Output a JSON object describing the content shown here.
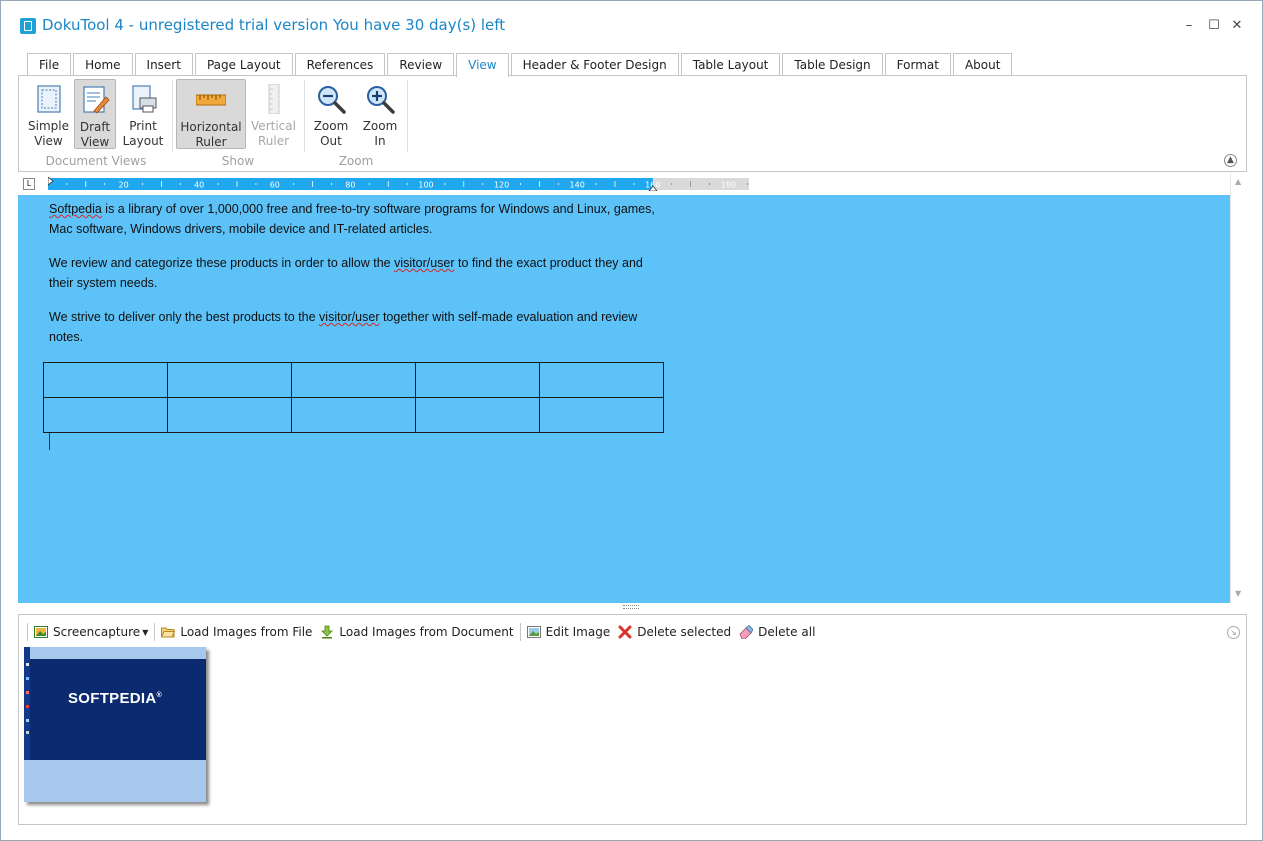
{
  "window": {
    "title": "DokuTool 4 - unregistered trial version You have 30 day(s) left",
    "controls": {
      "minimize": "–",
      "maximize": "☐",
      "close": "✕"
    }
  },
  "tabs": [
    {
      "label": "File"
    },
    {
      "label": "Home"
    },
    {
      "label": "Insert"
    },
    {
      "label": "Page Layout"
    },
    {
      "label": "References"
    },
    {
      "label": "Review"
    },
    {
      "label": "View"
    },
    {
      "label": "Header & Footer Design"
    },
    {
      "label": "Table Layout"
    },
    {
      "label": "Table Design"
    },
    {
      "label": "Format"
    },
    {
      "label": "About"
    }
  ],
  "active_tab": "View",
  "ribbon": {
    "document_views": {
      "label": "Document Views",
      "simple_view": {
        "line1": "Simple",
        "line2": "View"
      },
      "draft_view": {
        "line1": "Draft",
        "line2": "View",
        "pressed": true
      },
      "print_layout": {
        "line1": "Print",
        "line2": "Layout"
      }
    },
    "show": {
      "label": "Show",
      "horizontal_ruler": {
        "line1": "Horizontal",
        "line2": "Ruler",
        "pressed": true
      },
      "vertical_ruler": {
        "line1": "Vertical",
        "line2": "Ruler",
        "disabled": true
      }
    },
    "zoom": {
      "label": "Zoom",
      "zoom_out": {
        "line1": "Zoom",
        "line2": "Out"
      },
      "zoom_in": {
        "line1": "Zoom",
        "line2": "In"
      }
    }
  },
  "ruler": {
    "corner": "L",
    "ticks": [
      "20",
      "40",
      "60",
      "80",
      "100",
      "120",
      "140",
      "160",
      "180"
    ]
  },
  "document": {
    "paragraphs": [
      {
        "pre": "",
        "spell": "Softpedia",
        "post": " is a library of over 1,000,000 free and free-to-try software programs for Windows and Linux, games, Mac software, Windows drivers, mobile device and IT-related articles."
      },
      {
        "pre": "We review and categorize these products in order to allow the ",
        "spell": "visitor/user",
        "post": " to find the exact product they and their system needs."
      },
      {
        "pre": "We strive to deliver only the best products to the ",
        "spell": "visitor/user",
        "post": " together with self-made evaluation and review notes."
      }
    ],
    "table": {
      "rows": 2,
      "cols": 5
    }
  },
  "image_panel": {
    "toolbar": {
      "screencapture": "Screencapture",
      "load_from_file": "Load Images from File",
      "load_from_document": "Load Images from Document",
      "edit_image": "Edit Image",
      "delete_selected": "Delete selected",
      "delete_all": "Delete all"
    },
    "thumbnail": {
      "logo_text": "SOFTPEDIA",
      "logo_mark": "®"
    }
  },
  "colors": {
    "accent": "#1c86c8",
    "document_background": "#5cc2f7",
    "ruler_active": "#1fa8f0",
    "thumbnail_dark": "#0b2a70",
    "thumbnail_light": "#a7c7ec"
  }
}
